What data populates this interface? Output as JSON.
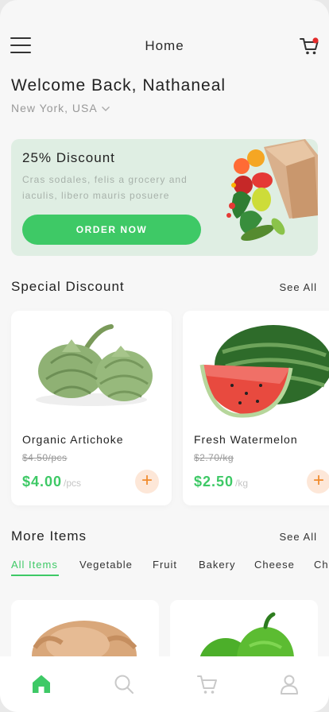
{
  "header": {
    "title": "Home",
    "colors": {
      "accent": "#3ec966",
      "badge": "#e32b2b"
    }
  },
  "welcome": {
    "greeting": "Welcome Back, Nathaneal",
    "location": "New York, USA"
  },
  "promo": {
    "title": "25% Discount",
    "text": "Cras sodales, felis a grocery and iaculis, libero mauris posuere",
    "button": "ORDER NOW"
  },
  "special": {
    "title": "Special Discount",
    "see_all": "See All",
    "products": [
      {
        "name": "Organic Artichoke",
        "old_price": "$4.50/pcs",
        "price": "$4.00",
        "unit": "/pcs",
        "add_icon": "plus-icon"
      },
      {
        "name": "Fresh Watermelon",
        "old_price": "$2.70/kg",
        "price": "$2.50",
        "unit": "/kg",
        "add_icon": "plus-icon"
      }
    ]
  },
  "more": {
    "title": "More Items",
    "see_all": "See All",
    "tabs": [
      "All Items",
      "Vegetable",
      "Fruit",
      "Bakery",
      "Cheese",
      "Ch"
    ],
    "active_tab": "All Items"
  },
  "bottom_nav": {
    "items": [
      "home-icon",
      "search-icon",
      "cart-icon",
      "profile-icon"
    ],
    "active": "home-icon"
  }
}
